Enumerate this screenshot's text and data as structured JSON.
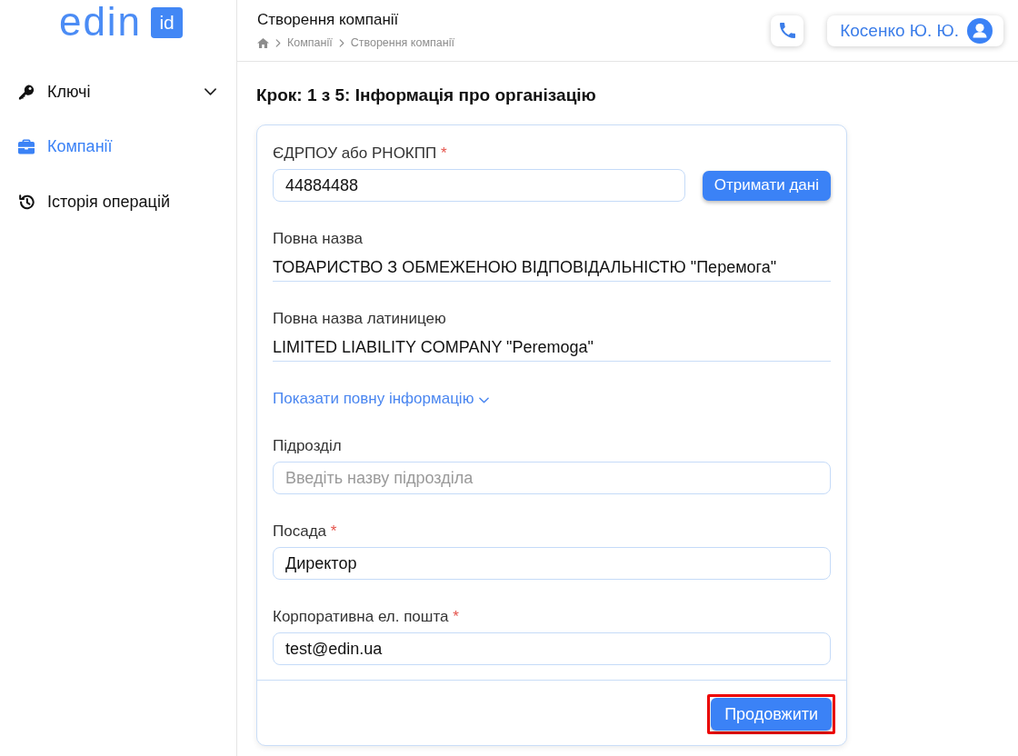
{
  "sidebar": {
    "logo": {
      "wordmark": "edin",
      "badge": "id"
    },
    "items": [
      {
        "kind": "keys",
        "label": "Ключі",
        "selected": false,
        "submenu": true
      },
      {
        "kind": "companies",
        "label": "Компанії",
        "selected": true,
        "submenu": false
      },
      {
        "kind": "history",
        "label": "Історія операцій",
        "selected": false,
        "submenu": false
      }
    ]
  },
  "header": {
    "title": "Створення компанії",
    "breadcrumbs": [
      {
        "kind": "home"
      },
      {
        "kind": "link",
        "label": "Компанії"
      },
      {
        "kind": "link",
        "label": "Створення компанії"
      }
    ],
    "user": {
      "name": "Косенко Ю. Ю."
    }
  },
  "step_title": "Крок: 1 з 5: Інформація про організацію",
  "form": {
    "fields": [
      {
        "kind": "input",
        "label": "ЄДРПОУ або РНОКПП",
        "required_mark": "*",
        "value": "44884488",
        "action": "Отримати дані"
      },
      {
        "kind": "readonly",
        "label": "Повна назва",
        "value": "ТОВАРИСТВО З ОБМЕЖЕНОЮ ВІДПОВІДАЛЬНІСТЮ \"Перемога\""
      },
      {
        "kind": "readonly",
        "label": "Повна назва латиницею",
        "value": "LIMITED LIABILITY COMPANY \"Peremoga\""
      },
      {
        "kind": "toggle",
        "label": "Показати повну інформацію",
        "expanded": false
      },
      {
        "kind": "input",
        "label": "Підрозділ",
        "placeholder": "Введіть назву підрозділа"
      },
      {
        "kind": "input",
        "label": "Посада",
        "required_mark": "*",
        "value": "Директор"
      },
      {
        "kind": "input",
        "label": "Корпоративна ел. пошта",
        "required_mark": "*",
        "value": "test@edin.ua"
      }
    ],
    "submit": {
      "label": "Продовжити",
      "highlighted": true
    }
  }
}
